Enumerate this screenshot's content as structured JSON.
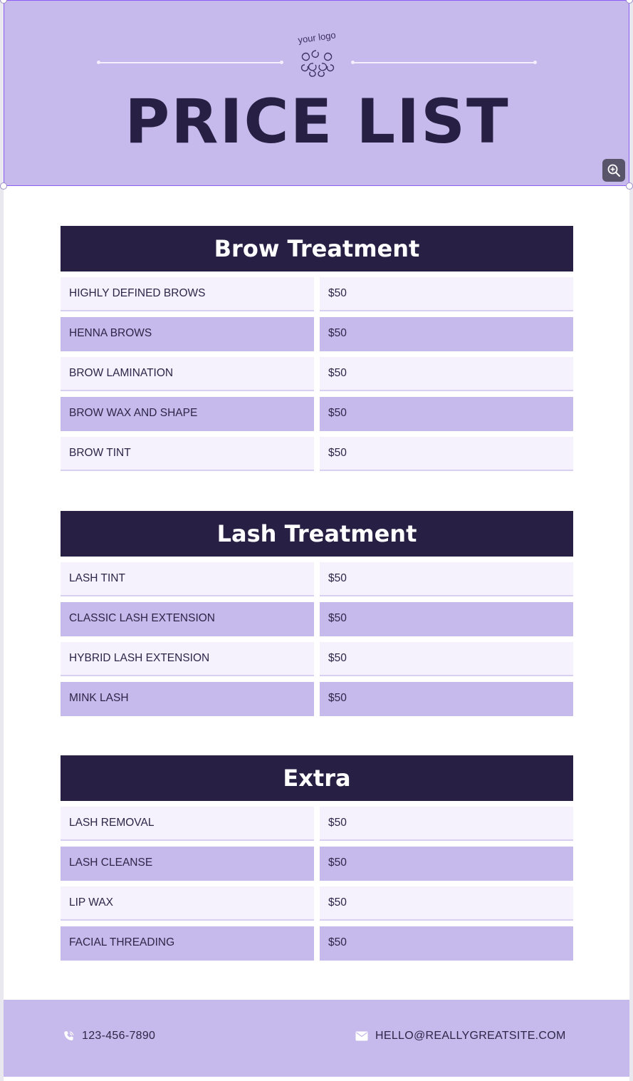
{
  "header": {
    "logo_text": "your logo",
    "title": "PRICE LIST"
  },
  "sections": [
    {
      "title": "Brow Treatment",
      "items": [
        {
          "name": "HIGHLY DEFINED BROWS",
          "price": "$50"
        },
        {
          "name": "HENNA BROWS",
          "price": "$50"
        },
        {
          "name": "BROW LAMINATION",
          "price": "$50"
        },
        {
          "name": "BROW WAX AND SHAPE",
          "price": "$50"
        },
        {
          "name": "BROW TINT",
          "price": "$50"
        }
      ]
    },
    {
      "title": "Lash Treatment",
      "items": [
        {
          "name": "LASH TINT",
          "price": "$50"
        },
        {
          "name": "CLASSIC LASH EXTENSION",
          "price": "$50"
        },
        {
          "name": "HYBRID LASH EXTENSION",
          "price": "$50"
        },
        {
          "name": "MINK LASH",
          "price": "$50"
        }
      ]
    },
    {
      "title": "Extra",
      "items": [
        {
          "name": "LASH REMOVAL",
          "price": "$50"
        },
        {
          "name": "LASH CLEANSE",
          "price": "$50"
        },
        {
          "name": "LIP WAX",
          "price": "$50"
        },
        {
          "name": "FACIAL THREADING",
          "price": "$50"
        }
      ]
    }
  ],
  "footer": {
    "phone": "123-456-7890",
    "email": "HELLO@REALLYGREATSITE.COM"
  },
  "colors": {
    "header_bg": "#c6b9eb",
    "section_header_bg": "#271f44",
    "row_light": "#f5f2fd",
    "row_dark": "#c6b9eb",
    "selection_border": "#8b5cf6"
  },
  "icons": {
    "zoom": "zoom-in-icon",
    "phone": "phone-icon",
    "email": "mail-icon",
    "logo": "swirl-logo-icon"
  }
}
